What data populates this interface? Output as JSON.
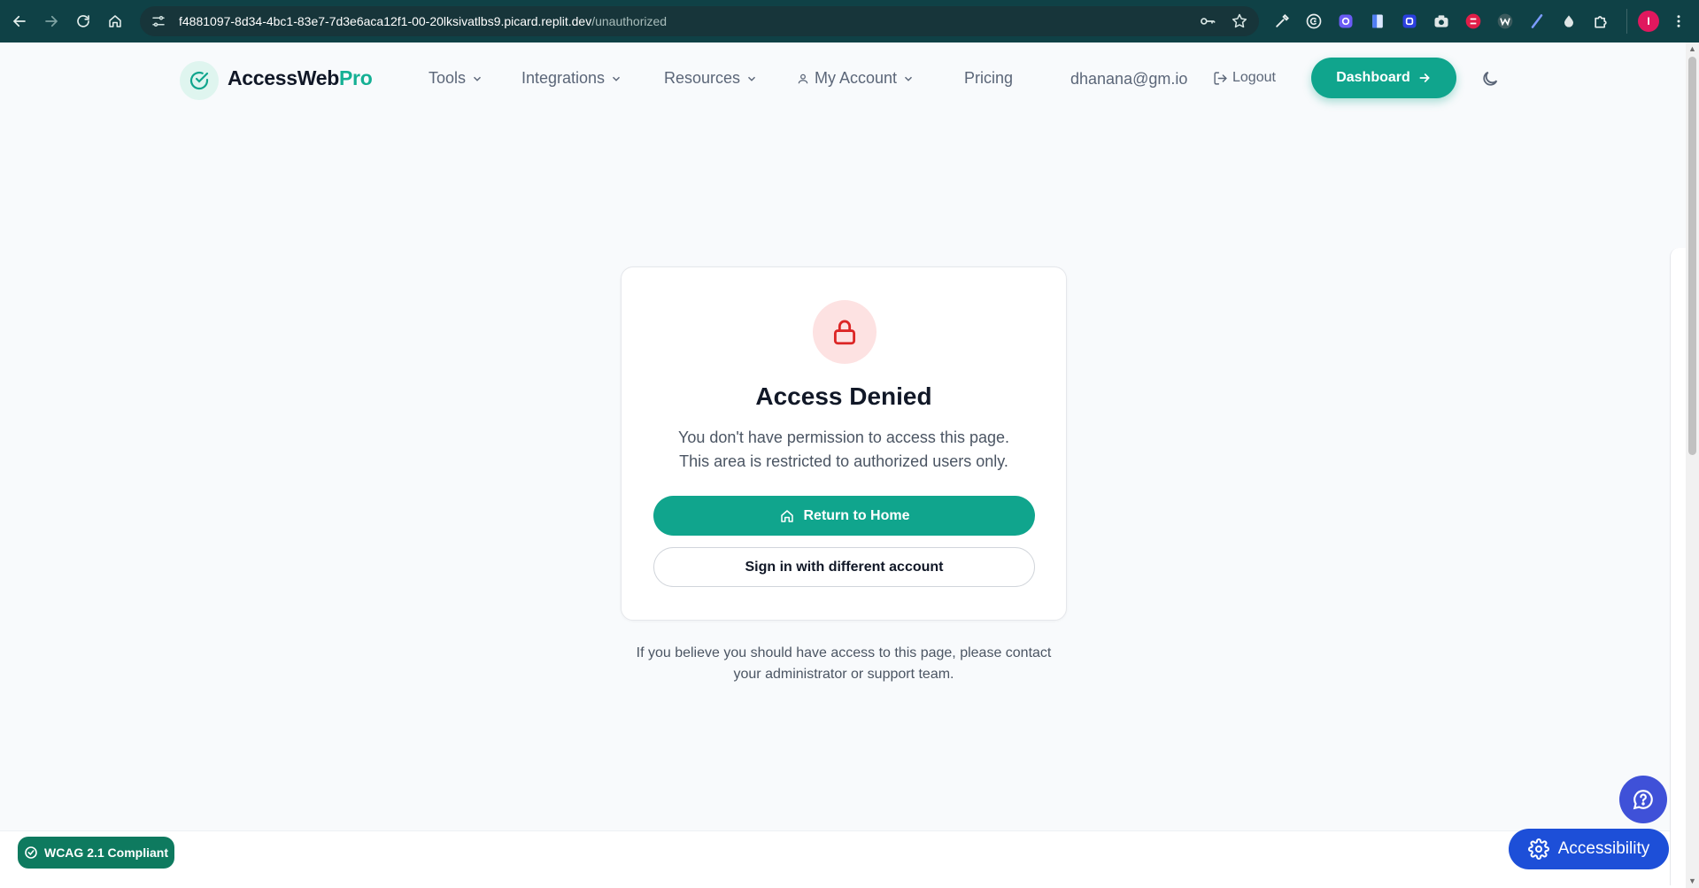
{
  "browser": {
    "url_host": "f4881097-8d34-4bc1-83e7-7d3e6aca12f1-00-20lksivatlbs9.picard.replit.dev",
    "url_path": "/unauthorized",
    "profile_initial": "I"
  },
  "header": {
    "logo_primary": "AccessWeb",
    "logo_accent": "Pro",
    "nav": {
      "tools": "Tools",
      "integrations": "Integrations",
      "resources": "Resources",
      "my_account": "My Account",
      "pricing": "Pricing"
    },
    "email": "dhanana@gm.io",
    "logout": "Logout",
    "dashboard": "Dashboard"
  },
  "card": {
    "title": "Access Denied",
    "message_line1": "You don't have permission to access this page.",
    "message_line2": "This area is restricted to authorized users only.",
    "home_button": "Return to Home",
    "signin_button": "Sign in with different account"
  },
  "footer_note": {
    "line1": "If you believe you should have access to this page, please contact",
    "line2": "your administrator or support team."
  },
  "badges": {
    "wcag": "WCAG 2.1 Compliant",
    "accessibility": "Accessibility"
  },
  "colors": {
    "brand": "#10a58d",
    "danger": "#dc2626",
    "accessibility_blue": "#1d4fd8",
    "browser_chrome": "#0f4146"
  }
}
